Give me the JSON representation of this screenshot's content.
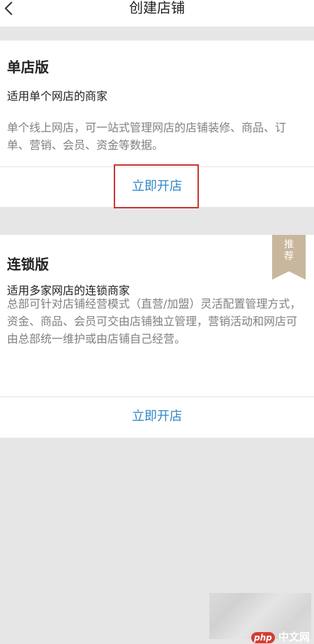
{
  "header": {
    "title": "创建店铺",
    "back_icon": "chevron-left-icon"
  },
  "cards": [
    {
      "title": "单店版",
      "subtitle": "适用单个网店的商家",
      "description": "单个线上网店，可一站式管理网店的店铺装修、商品、订单、营销、会员、资金等数据。",
      "action": "立即开店"
    },
    {
      "title": "连锁版",
      "subtitle": "适用多家网店的连锁商家",
      "description": "总部可针对店铺经营模式（直营/加盟）灵活配置管理方式，资金、商品、会员可交由店铺独立管理，营销活动和网店可由总部统一维护或由店铺自己经营。",
      "action": "立即开店",
      "badge": "推荐"
    }
  ],
  "watermark": {
    "logo_php": "php",
    "logo_text": "中文网"
  },
  "colors": {
    "action_blue": "#2f87c8",
    "highlight_red": "#c8332f",
    "badge_gold": "#c8b79c",
    "page_gray": "#e6e6e6"
  }
}
